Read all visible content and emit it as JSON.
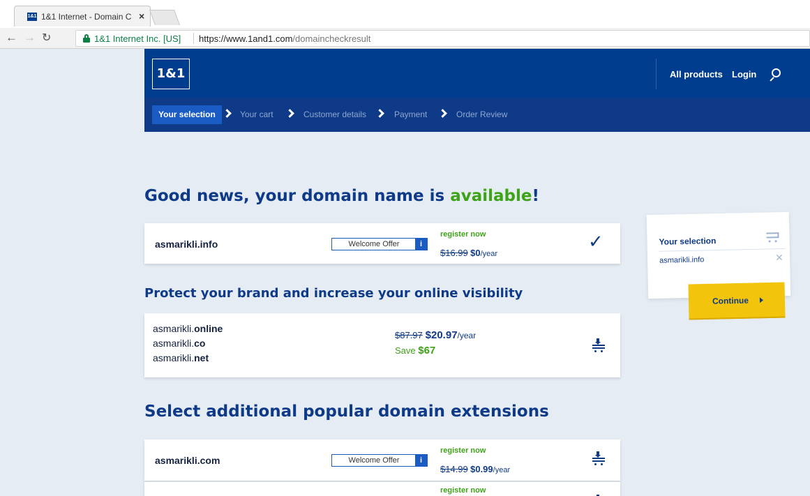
{
  "browser": {
    "tab_title": "1&1 Internet - Domain C",
    "tab_favicon_text": "1&1",
    "secure_label": "1&1 Internet Inc. [US]",
    "url_host": "https://www.1and1.com",
    "url_path": "/domaincheckresult"
  },
  "header": {
    "logo": "1&1",
    "all_products": "All products",
    "login": "Login"
  },
  "steps": [
    "Your selection",
    "Your cart",
    "Customer details",
    "Payment",
    "Order Review"
  ],
  "headline": {
    "prefix": "Good news, your domain name is ",
    "highlight": "available",
    "suffix": "!"
  },
  "selected_domain": {
    "name": "asmarikli.info",
    "offer_label": "Welcome Offer",
    "info_label": "i",
    "register_label": "register now",
    "old_price": "$16.99",
    "new_price": "$0",
    "per": "/year"
  },
  "protect": {
    "heading": "Protect your brand and increase your online visibility",
    "domains": [
      {
        "base": "asmarikli.",
        "tld": "online"
      },
      {
        "base": "asmarikli.",
        "tld": "co"
      },
      {
        "base": "asmarikli.",
        "tld": "net"
      }
    ],
    "old_price": "$87.97",
    "new_price": "$20.97",
    "per": "/year",
    "save_label": "Save ",
    "save_amount": "$67"
  },
  "additional": {
    "heading": "Select additional popular domain extensions",
    "rows": [
      {
        "name": "asmarikli.com",
        "offer_label": "Welcome Offer",
        "info_label": "i",
        "register_label": "register now",
        "old_price": "$14.99",
        "new_price": "$0.99",
        "per": "/year"
      },
      {
        "register_label": "register now"
      }
    ]
  },
  "selection_panel": {
    "title": "Your selection",
    "item": "asmarikli.info",
    "remove": "✕",
    "continue_label": "Continue"
  },
  "colors": {
    "brand_blue": "#003d8f",
    "green": "#3fa318",
    "yellow": "#f2c40c"
  }
}
